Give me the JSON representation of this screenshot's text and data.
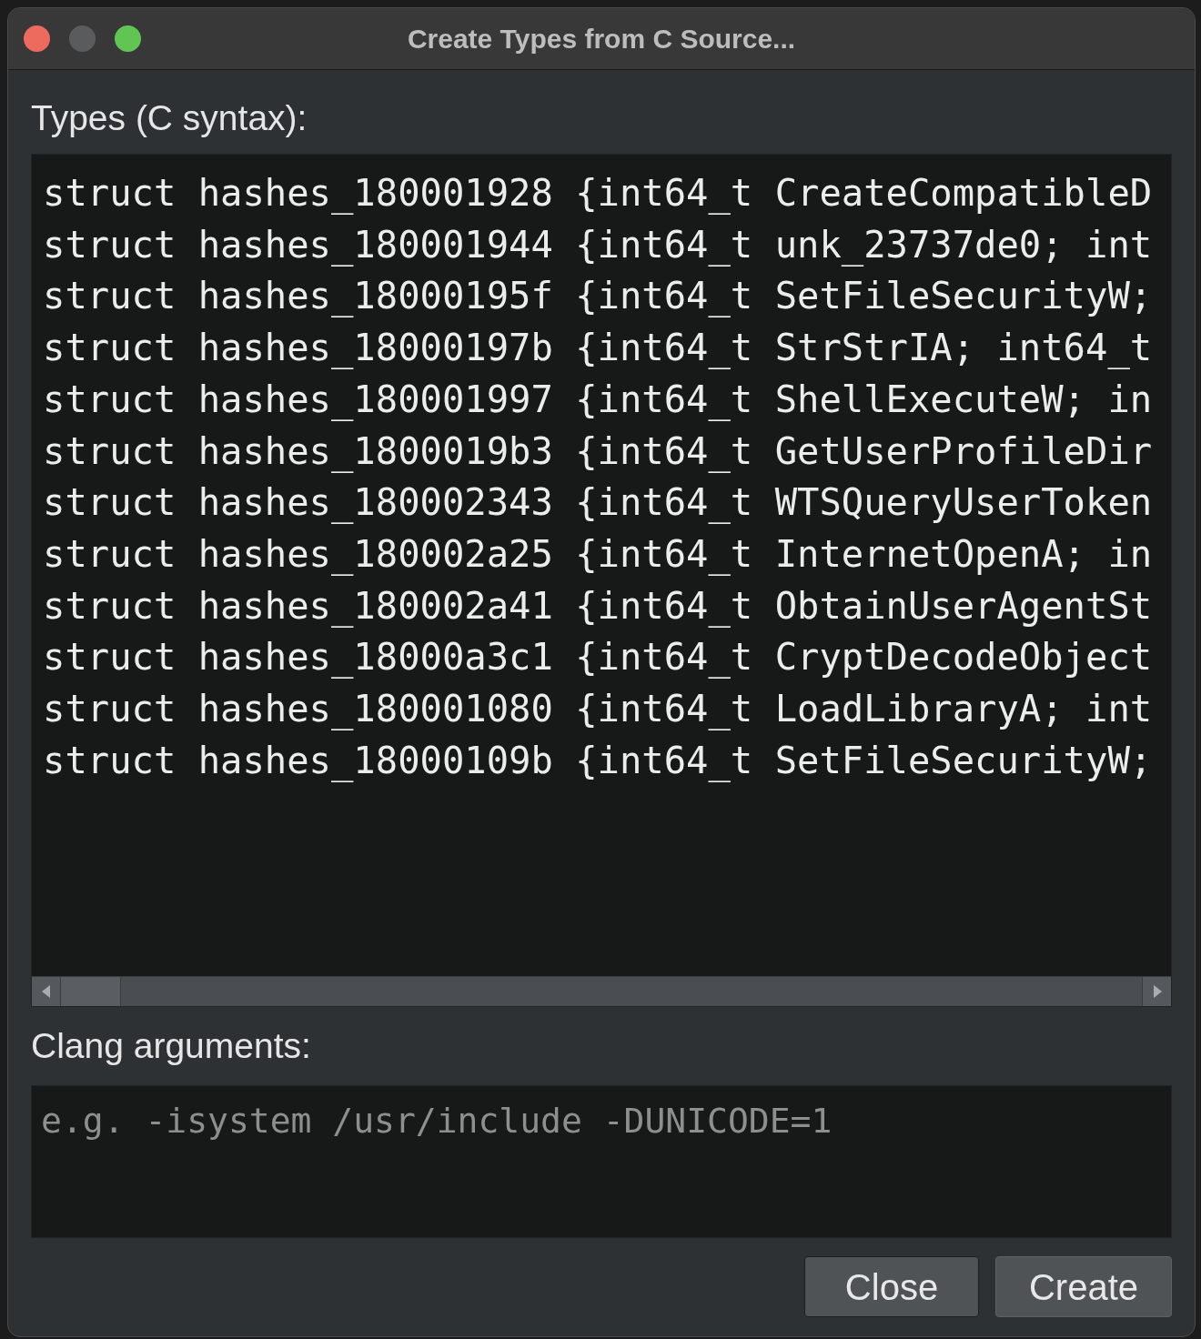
{
  "window": {
    "title": "Create Types from C Source...",
    "controls": [
      {
        "color": "#ed6a5e"
      },
      {
        "color": "#5a5b5d"
      },
      {
        "color": "#61c554"
      }
    ]
  },
  "types_label": "Types (C syntax):",
  "types_editor": {
    "lines": [
      "struct hashes_180001928 {int64_t CreateCompatibleD",
      "struct hashes_180001944 {int64_t unk_23737de0; int",
      "struct hashes_18000195f {int64_t SetFileSecurityW;",
      "struct hashes_18000197b {int64_t StrStrIA; int64_t",
      "struct hashes_180001997 {int64_t ShellExecuteW; in",
      "struct hashes_1800019b3 {int64_t GetUserProfileDir",
      "struct hashes_180002343 {int64_t WTSQueryUserToken",
      "struct hashes_180002a25 {int64_t InternetOpenA; in",
      "struct hashes_180002a41 {int64_t ObtainUserAgentSt",
      "struct hashes_18000a3c1 {int64_t CryptDecodeObject",
      "struct hashes_180001080 {int64_t LoadLibraryA; int",
      "struct hashes_18000109b {int64_t SetFileSecurityW;"
    ]
  },
  "clang_label": "Clang arguments:",
  "clang_field": {
    "placeholder": "e.g. -isystem /usr/include -DUNICODE=1"
  },
  "buttons": [
    "Close",
    "Create"
  ]
}
